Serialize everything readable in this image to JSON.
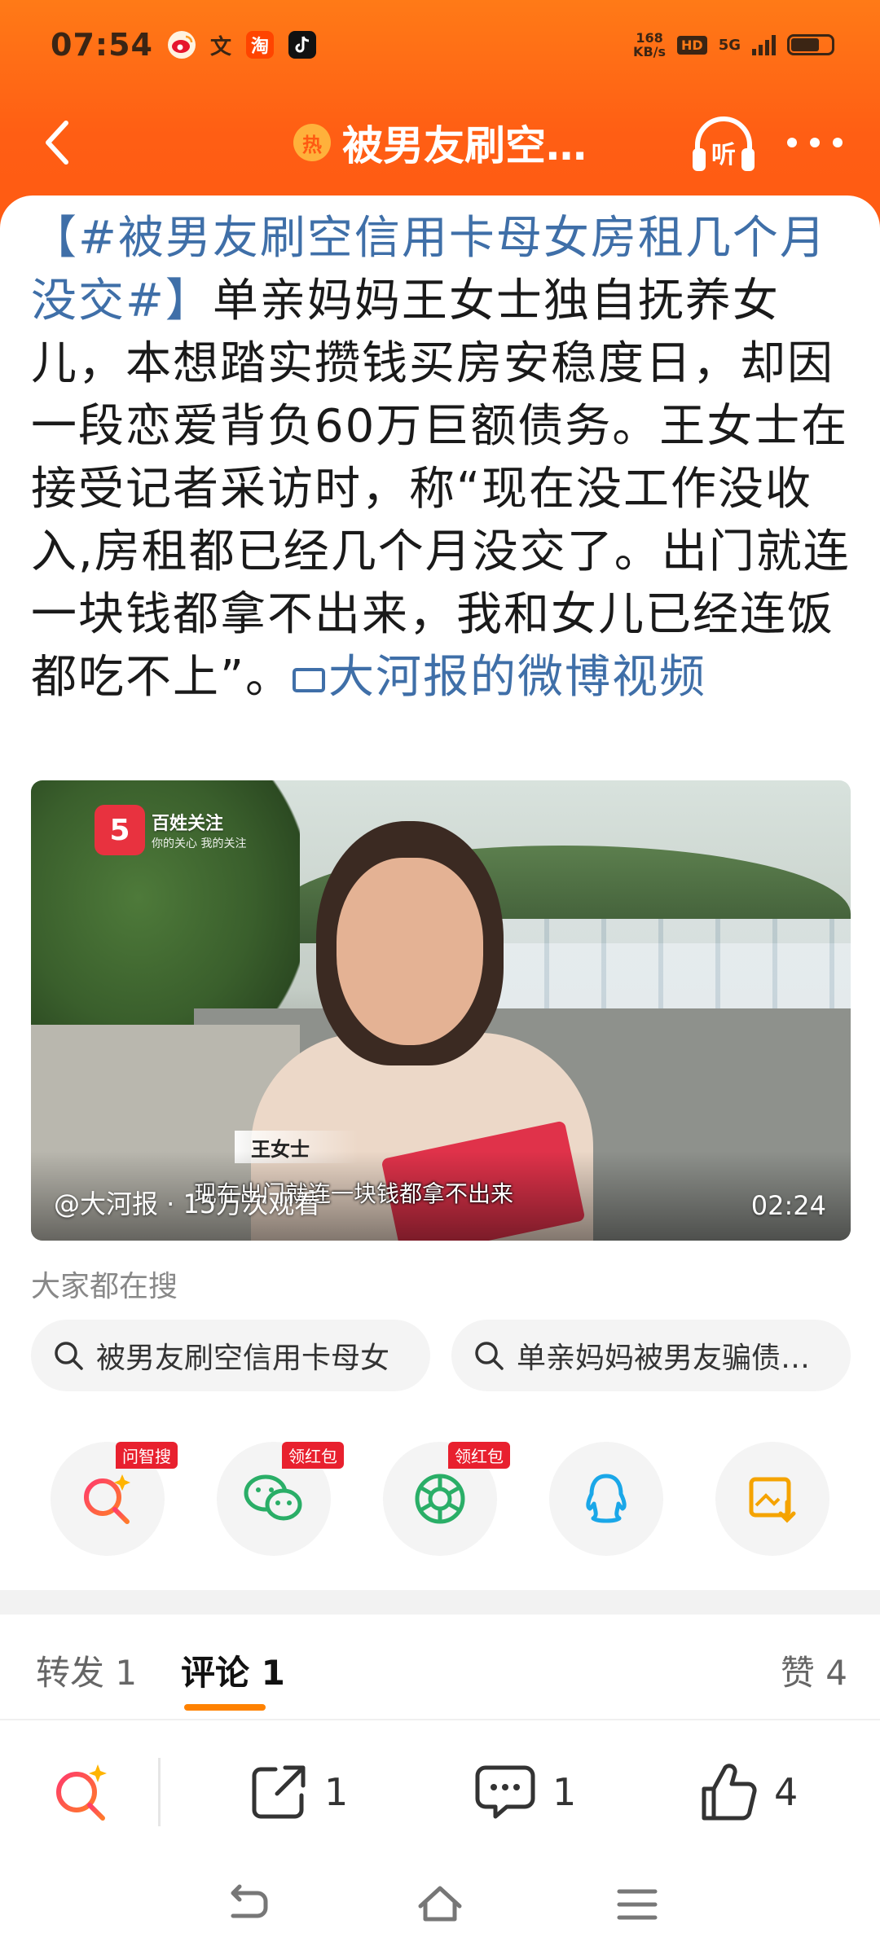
{
  "status_bar": {
    "time": "07:54",
    "app_icons": [
      "weibo-icon",
      "wen-icon",
      "taobao-icon",
      "tiktok-icon"
    ],
    "wen_glyph": "文",
    "tao_glyph": "淘",
    "net_speed_top": "168",
    "net_speed_bottom": "KB/s",
    "hd": "HD",
    "network": "5G"
  },
  "nav": {
    "hot_badge": "热",
    "title": "被男友刷空…",
    "listen_label": "听"
  },
  "post": {
    "topic": "【#被男友刷空信用卡母女房租几个月没交#】",
    "body": "单亲妈妈王女士独自抚养女儿，本想踏实攒钱买房安稳度日，却因一段恋爱背负60万巨额债务。王女士在接受记者采访时，称“现在没工作没收入,房租都已经几个月没交了。出门就连一块钱都拿不出来，我和女儿已经连饭都吃不上”。",
    "video_link": "大河报的微博视频"
  },
  "video": {
    "logo_mark": "5",
    "logo_text": "百姓关注",
    "logo_sub": "你的关心 我的关注",
    "name_tag": "王女士",
    "subtitle": "现在出门就连一块钱都拿不出来",
    "views": "@大河报 · 15万次观看",
    "duration": "02:24"
  },
  "search": {
    "label": "大家都在搜",
    "chips": [
      "被男友刷空信用卡母女",
      "单亲妈妈被男友骗债…"
    ]
  },
  "share": {
    "items": [
      {
        "icon": "ai-search-icon",
        "tag": "问智搜"
      },
      {
        "icon": "wechat-icon",
        "tag": "领红包"
      },
      {
        "icon": "moments-icon",
        "tag": "领红包"
      },
      {
        "icon": "qq-icon",
        "tag": ""
      },
      {
        "icon": "save-image-icon",
        "tag": ""
      }
    ]
  },
  "tabs": {
    "repost": "转发 1",
    "comment": "评论 1",
    "like": "赞 4"
  },
  "actions": {
    "repost_count": "1",
    "comment_count": "1",
    "like_count": "4"
  },
  "colors": {
    "header": "#ff6a15",
    "link": "#3f6fa8",
    "accent": "#ff8200",
    "red_tag": "#e8202e"
  }
}
